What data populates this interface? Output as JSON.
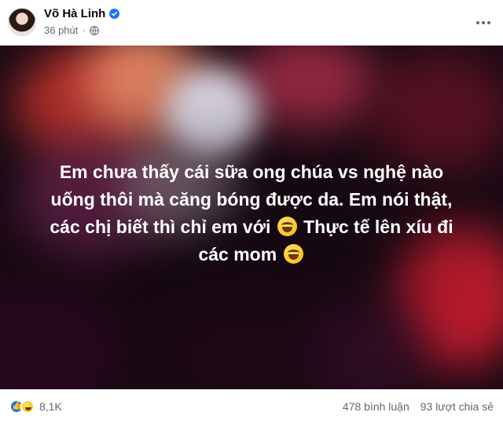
{
  "post": {
    "author": "Võ Hà Linh",
    "time": "36 phút",
    "verified": true,
    "text_lines": [
      "Em chưa thấy cái sữa ong chúa vs nghệ nào",
      "uống thôi mà căng bóng được da. Em nói thật,",
      "các chị biết thì chỉ em với",
      "Thực tế lên xíu đi",
      "các mom"
    ],
    "emoji_name": "grinning-squinting-face"
  },
  "footer": {
    "reaction_count": "8,1K",
    "comments": "478 bình luận",
    "shares": "93 lượt chia sẻ"
  },
  "colors": {
    "verified": "#1877f2",
    "like": "#1877f2",
    "muted_text": "#65676b"
  }
}
